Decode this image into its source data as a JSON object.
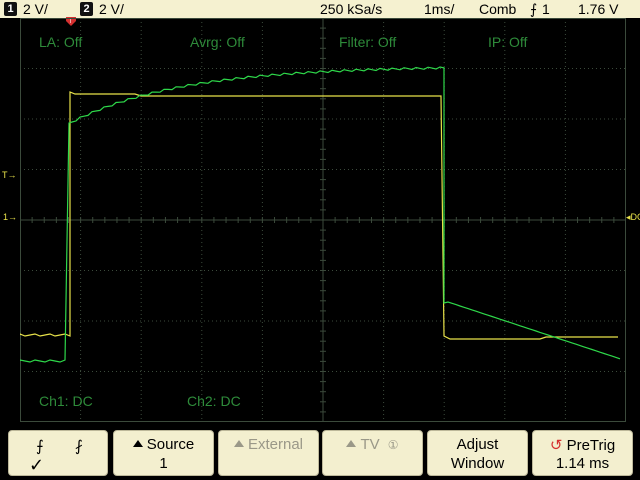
{
  "status": {
    "ch1_num": "1",
    "ch1_scale": "2 V/",
    "ch2_num": "2",
    "ch2_scale": "2 V/",
    "sample_rate": "250 kSa/s",
    "timebase": "1ms/",
    "acq_mode": "Comb",
    "trigger_symbol": "⨍",
    "trigger_source": "1",
    "trigger_level": "1.76 V"
  },
  "screen_labels": {
    "la": "LA: Off",
    "avrg": "Avrg: Off",
    "filter": "Filter: Off",
    "ip": "IP: Off",
    "ch1": "Ch1: DC",
    "ch2": "Ch2: DC"
  },
  "markers": {
    "trigger_pos": "T",
    "trigger_level": "T",
    "ch_ref": "1",
    "dc": "DC"
  },
  "softkeys": {
    "slope_rising": "⨍",
    "slope_falling": "⨏",
    "slope_selected_mark": "✓",
    "source_label": "Source",
    "source_value": "1",
    "external_label": "External",
    "tv_label": "TV",
    "tv_icon": "①",
    "adjust_line1": "Adjust",
    "adjust_line2": "Window",
    "pretrig_label": "PreTrig",
    "pretrig_value": "1.14 ms"
  },
  "colors": {
    "background": "#000000",
    "grid": "#3b4a3b",
    "ch1": "#e8e24a",
    "ch2": "#2ed84a",
    "osd_text": "#2e8b3a",
    "bar": "#f5f1d0",
    "trigger_marker": "#d53030"
  },
  "icons": {
    "trigger_position": "trigger-position-icon",
    "pretrig": "counterclockwise-arrow-icon"
  }
}
